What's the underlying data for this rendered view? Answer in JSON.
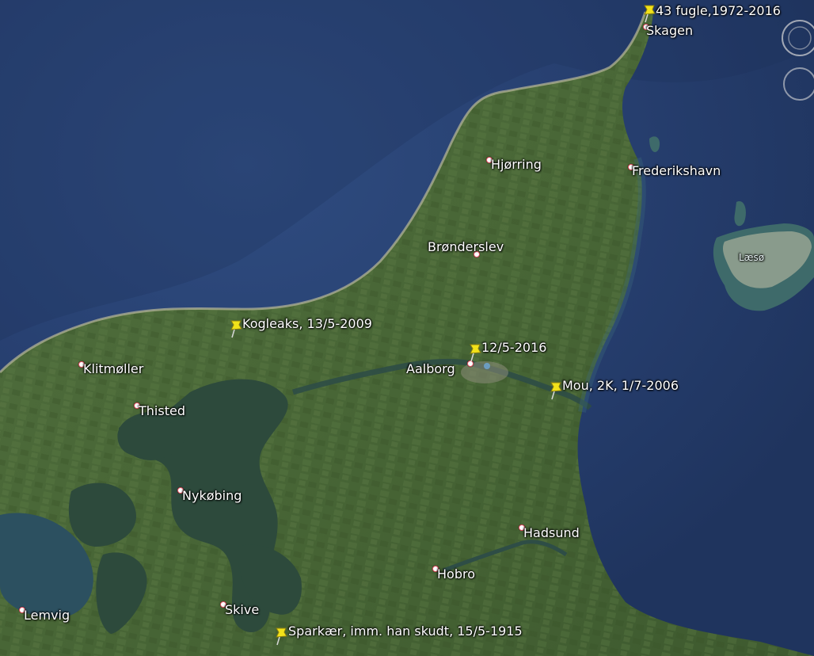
{
  "towns": [
    {
      "id": "skagen",
      "name": "Skagen"
    },
    {
      "id": "frederikshavn",
      "name": "Frederikshavn"
    },
    {
      "id": "hjorring",
      "name": "Hjørring"
    },
    {
      "id": "bronderslev",
      "name": "Brønderslev"
    },
    {
      "id": "aalborg",
      "name": "Aalborg"
    },
    {
      "id": "klitmoller",
      "name": "Klitmøller"
    },
    {
      "id": "thisted",
      "name": "Thisted"
    },
    {
      "id": "nykobing",
      "name": "Nykøbing"
    },
    {
      "id": "hadsund",
      "name": "Hadsund"
    },
    {
      "id": "hobro",
      "name": "Hobro"
    },
    {
      "id": "skive",
      "name": "Skive"
    },
    {
      "id": "lemvig",
      "name": "Lemvig"
    }
  ],
  "island_label": "Læsø",
  "placemarks": [
    {
      "id": "skagen-pin",
      "label": "43 fugle,1972-2016"
    },
    {
      "id": "kogleaks-pin",
      "label": "Kogleaks, 13/5-2009"
    },
    {
      "id": "aalborg-pin",
      "label": "12/5-2016"
    },
    {
      "id": "mou-pin",
      "label": "Mou, 2K, 1/7-2006"
    },
    {
      "id": "sparkaer-pin",
      "label": "Sparkær, imm. han skudt, 15/5-1915"
    }
  ],
  "colors": {
    "sea": "#263e6e",
    "land": "#4a6a3a",
    "fjord": "#2d4a3c",
    "pin": "#f2e21a"
  }
}
